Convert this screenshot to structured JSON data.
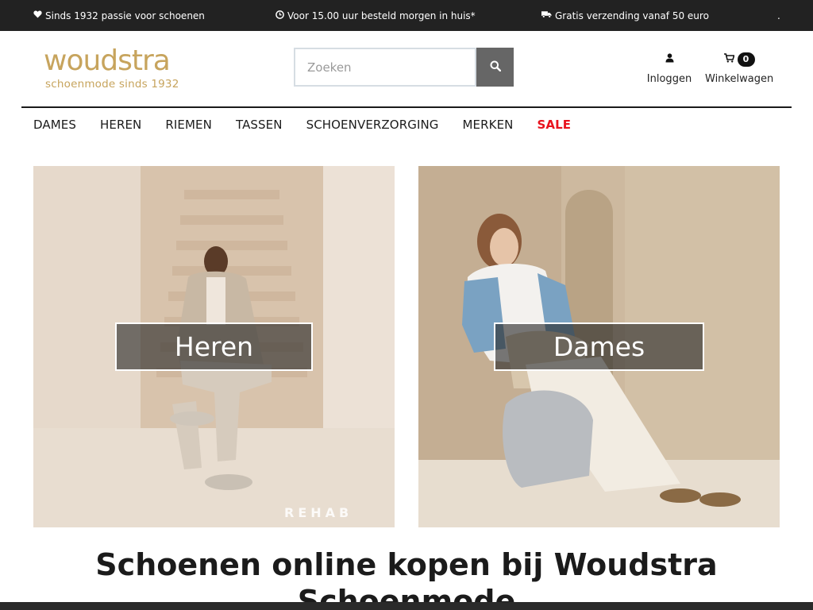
{
  "topbar": {
    "usp1": {
      "icon": "heart-icon",
      "text": "Sinds 1932 passie voor schoenen"
    },
    "usp2": {
      "icon": "clock-icon",
      "text": "Voor 15.00 uur besteld morgen in huis*"
    },
    "usp3": {
      "icon": "truck-icon",
      "text": "Gratis verzending vanaf 50 euro"
    },
    "dot": "."
  },
  "header": {
    "logo": {
      "wordmark": "woudstra",
      "tagline": "schoenmode sinds 1932"
    },
    "search": {
      "placeholder": "Zoeken",
      "value": "",
      "button_icon": "search-icon"
    },
    "login": {
      "icon": "user-icon",
      "label": "Inloggen"
    },
    "cart": {
      "icon": "cart-icon",
      "label": "Winkelwagen",
      "count": "0"
    }
  },
  "nav": {
    "items": [
      "DAMES",
      "HEREN",
      "RIEMEN",
      "TASSEN",
      "SCHOENVERZORGING",
      "MERKEN"
    ],
    "sale": "SALE"
  },
  "hero": {
    "left": {
      "label": "Heren",
      "watermark": "REHAB"
    },
    "right": {
      "label": "Dames"
    }
  },
  "main": {
    "heading": "Schoenen online kopen bij Woudstra Schoenmode"
  },
  "colors": {
    "topbar_bg": "#222222",
    "brand_gold": "#c7a45d",
    "sale_red": "#e8121d",
    "search_button": "#666666"
  }
}
